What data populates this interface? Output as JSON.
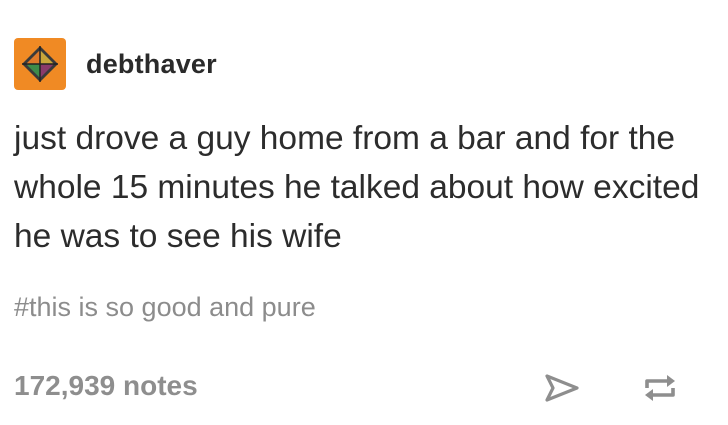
{
  "post": {
    "username": "debthaver",
    "avatar_icon": "orange-diamond-avatar-icon",
    "body": "just drove a guy home from a bar and for the whole 15 minutes he talked about how excited he was to see his wife",
    "tags": "#this is so good and pure",
    "notes": "172,939 notes",
    "share_icon": "share-arrow-icon",
    "reblog_icon": "reblog-icon"
  },
  "colors": {
    "avatar_background": "#f08a24",
    "text": "#2c2c2c",
    "muted": "#8c8c8c"
  }
}
